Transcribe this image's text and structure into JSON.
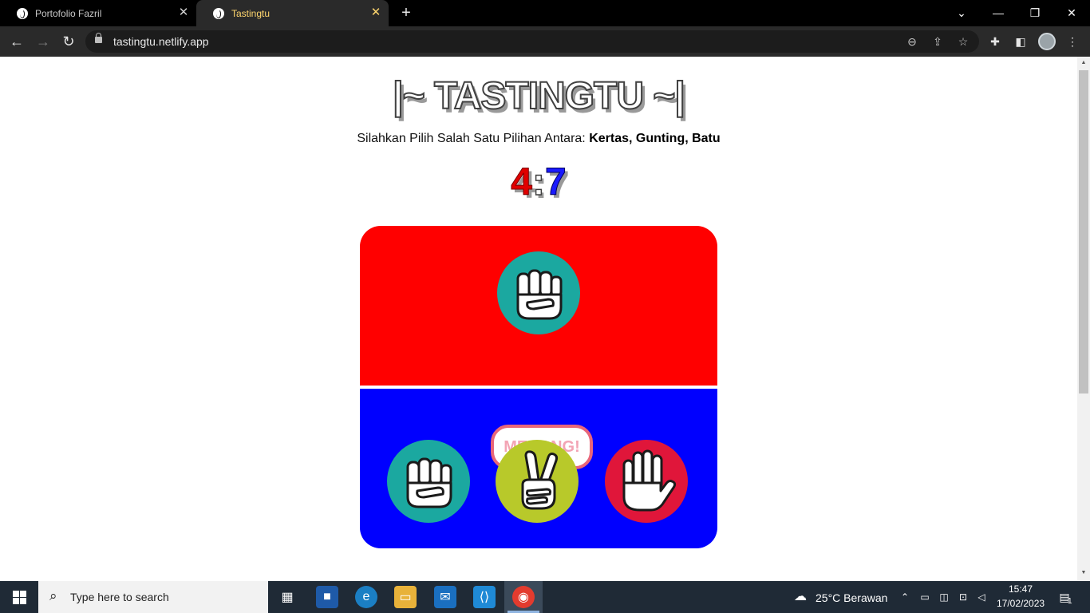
{
  "browser": {
    "tabs": [
      {
        "title": "Portofolio Fazril",
        "active": false
      },
      {
        "title": "Tastingtu",
        "active": true
      }
    ],
    "new_tab_label": "+",
    "url": "tastingtu.netlify.app"
  },
  "game": {
    "title": "|~ TASTINGTU ~|",
    "instruction_prefix": "Silahkan Pilih Salah Satu Pilihan Antara: ",
    "instruction_options": "Kertas, Gunting, Batu",
    "score_computer": "4",
    "score_separator": ":",
    "score_player": "7",
    "computer_choice": "batu",
    "result_text": "MENANG!",
    "player_choices": [
      {
        "id": "batu",
        "color": "#1ba8a0"
      },
      {
        "id": "gunting",
        "color": "#b8c92a"
      },
      {
        "id": "kertas",
        "color": "#e0163a"
      }
    ],
    "colors": {
      "computer_area": "#ff0000",
      "player_area": "#0000ff",
      "score_computer": "#e00000",
      "score_player": "#1a1aff",
      "result_border": "#e8667a"
    }
  },
  "taskbar": {
    "search_placeholder": "Type here to search",
    "weather": "25°C  Berawan",
    "time": "15:47",
    "date": "17/02/2023",
    "notification_count": "1"
  }
}
